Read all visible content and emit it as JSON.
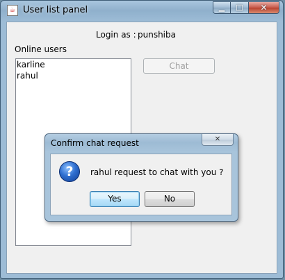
{
  "window": {
    "title": "User list panel",
    "icon": "java-icon"
  },
  "window_buttons": {
    "minimize": "▁",
    "maximize": "□",
    "close": "✕"
  },
  "panel": {
    "login_label": "Login as :",
    "login_user": "punshiba",
    "online_label": "Online users",
    "users": [
      "karline",
      "rahul"
    ],
    "chat_button": "Chat"
  },
  "dialog": {
    "title": "Confirm chat request",
    "close": "✕",
    "icon": "question-icon",
    "message": "rahul request to chat with you ?",
    "yes": "Yes",
    "no": "No"
  }
}
